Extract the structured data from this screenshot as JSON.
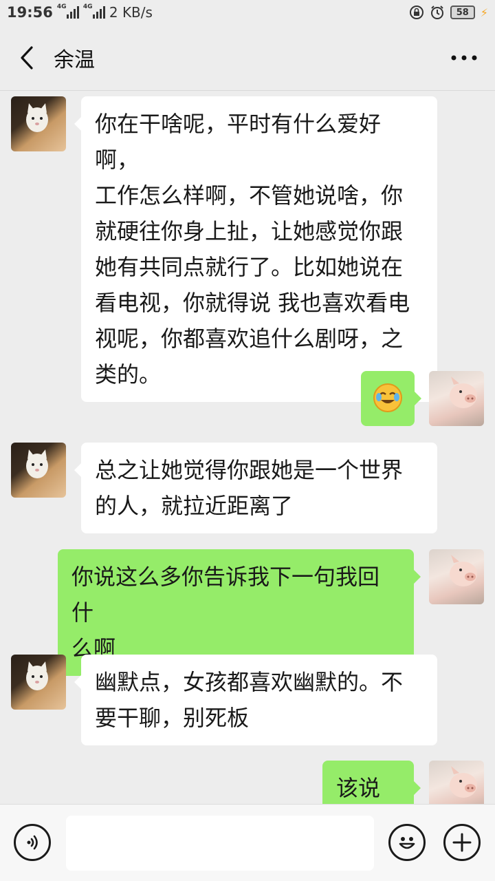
{
  "status_bar": {
    "time": "19:56",
    "network_1": "4G",
    "network_2": "4G",
    "speed": "2 KB/s",
    "battery": "58"
  },
  "header": {
    "back_icon": "chevron-left-icon",
    "title": "余温",
    "more_icon": "more-horizontal-icon"
  },
  "messages": [
    {
      "side": "left",
      "avatar": "cat",
      "lines": [
        "你在干啥呢，平时有什么爱好啊，",
        "工作怎么样啊，不管她说啥，你",
        "就硬往你身上扯，让她感觉你跟",
        "她有共同点就行了。比如她说在",
        "看电视，你就得说 我也喜欢看电",
        "视呢，你都喜欢追什么剧呀，之",
        "类的。"
      ]
    },
    {
      "side": "right",
      "avatar": "pig",
      "emoji": "face-with-tears-of-joy-icon"
    },
    {
      "side": "left",
      "avatar": "cat",
      "lines": [
        "总之让她觉得你跟她是一个世界",
        "的人，就拉近距离了"
      ]
    },
    {
      "side": "right",
      "avatar": "pig",
      "lines": [
        "你说这么多你告诉我下一句我回什",
        "么啊"
      ]
    },
    {
      "side": "left",
      "avatar": "cat",
      "lines": [
        "幽默点，女孩都喜欢幽默的。不",
        "要干聊，别死板"
      ]
    },
    {
      "side": "right",
      "avatar": "pig",
      "lines": [
        "该说啥"
      ]
    }
  ],
  "input_bar": {
    "voice_icon": "voice-icon",
    "message_value": "",
    "emoji_icon": "smiley-icon",
    "add_icon": "plus-icon"
  },
  "colors": {
    "background": "#ededed",
    "bubble_left": "#ffffff",
    "bubble_right": "#95ec69"
  }
}
